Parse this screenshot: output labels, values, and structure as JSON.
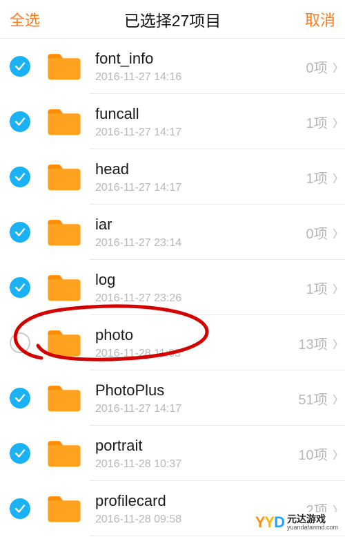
{
  "header": {
    "select_all": "全选",
    "title": "已选择27项目",
    "cancel": "取消"
  },
  "count_suffix": "项",
  "items": [
    {
      "name": "font_info",
      "date": "2016-11-27 14:16",
      "count": 0,
      "selected": true
    },
    {
      "name": "funcall",
      "date": "2016-11-27 14:17",
      "count": 1,
      "selected": true
    },
    {
      "name": "head",
      "date": "2016-11-27 14:17",
      "count": 1,
      "selected": true
    },
    {
      "name": "iar",
      "date": "2016-11-27 23:14",
      "count": 0,
      "selected": true
    },
    {
      "name": "log",
      "date": "2016-11-27 23:26",
      "count": 1,
      "selected": true
    },
    {
      "name": "photo",
      "date": "2016-11-28 11:03",
      "count": 13,
      "selected": false
    },
    {
      "name": "PhotoPlus",
      "date": "2016-11-27 14:17",
      "count": 51,
      "selected": true
    },
    {
      "name": "portrait",
      "date": "2016-11-28 10:37",
      "count": 10,
      "selected": true
    },
    {
      "name": "profilecard",
      "date": "2016-11-28 09:58",
      "count": 2,
      "selected": true
    }
  ],
  "watermark": {
    "brand": "元达游戏",
    "url": "yuandafanmd.com"
  },
  "annotation_color": "#d40000"
}
